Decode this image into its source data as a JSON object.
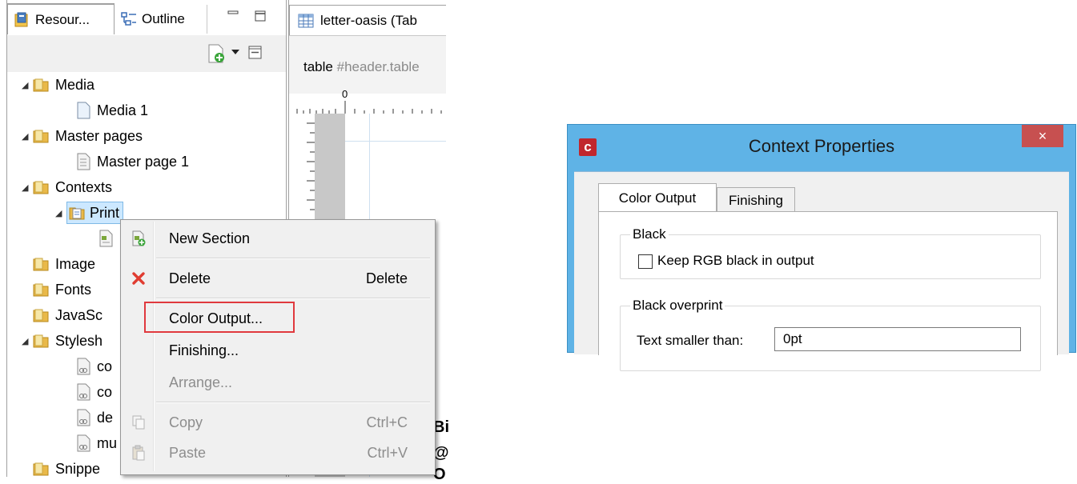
{
  "resources_view": {
    "tabs": [
      {
        "label": "Resour...",
        "icon": "resources-icon"
      },
      {
        "label": "Outline",
        "icon": "outline-icon"
      }
    ],
    "minimize_glyph": "▭",
    "tree": [
      {
        "label": "Media",
        "expanded": true,
        "icon": "folder-icon"
      },
      {
        "label": "Media 1",
        "icon": "page-icon",
        "level": 2
      },
      {
        "label": "Master pages",
        "expanded": true,
        "icon": "folder-icon"
      },
      {
        "label": "Master page 1",
        "icon": "page-icon",
        "level": 2
      },
      {
        "label": "Contexts",
        "expanded": true,
        "icon": "folder-icon"
      },
      {
        "label": "Print",
        "expanded": true,
        "selected": true,
        "icon": "print-context-icon",
        "level": 2
      },
      {
        "label": "",
        "icon": "section-icon",
        "level": 3
      },
      {
        "label": "Image",
        "icon": "folder-icon"
      },
      {
        "label": "Fonts",
        "icon": "folder-icon"
      },
      {
        "label": "JavaSc",
        "icon": "folder-icon"
      },
      {
        "label": "Stylesh",
        "expanded": true,
        "icon": "folder-icon"
      },
      {
        "label": "co",
        "icon": "stylesheet-icon",
        "level": 2
      },
      {
        "label": "co",
        "icon": "stylesheet-icon",
        "level": 2
      },
      {
        "label": "de",
        "icon": "stylesheet-icon",
        "level": 2
      },
      {
        "label": "mu",
        "icon": "stylesheet-icon",
        "level": 2
      },
      {
        "label": "Snippe",
        "icon": "folder-icon"
      }
    ]
  },
  "editor": {
    "tab_label": "letter-oasis (Tab",
    "breadcrumb_element": "table",
    "breadcrumb_selector": "#header.table",
    "ruler_zero": "0",
    "fragments": [
      "Bi",
      "@",
      "O"
    ]
  },
  "context_menu": {
    "items": [
      {
        "label": "New Section",
        "shortcut": "",
        "icon": "new-section-icon",
        "enabled": true
      },
      {
        "label": "Delete",
        "shortcut": "Delete",
        "icon": "delete-x-icon",
        "enabled": true
      },
      {
        "label": "Color Output...",
        "shortcut": "",
        "icon": "",
        "enabled": true,
        "highlighted": true
      },
      {
        "label": "Finishing...",
        "shortcut": "",
        "icon": "",
        "enabled": true
      },
      {
        "label": "Arrange...",
        "shortcut": "",
        "icon": "",
        "enabled": false
      },
      {
        "label": "Copy",
        "shortcut": "Ctrl+C",
        "icon": "copy-icon",
        "enabled": false
      },
      {
        "label": "Paste",
        "shortcut": "Ctrl+V",
        "icon": "paste-icon",
        "enabled": false
      }
    ],
    "highlight_color": "#e0393e"
  },
  "dialog": {
    "app_icon_letter": "c",
    "title": "Context Properties",
    "close_glyph": "×",
    "tabs": [
      "Color Output",
      "Finishing"
    ],
    "active_tab": "Color Output",
    "groups": {
      "black": {
        "legend": "Black",
        "checkbox_label": "Keep RGB black in output",
        "checked": false
      },
      "overprint": {
        "legend": "Black overprint",
        "field_label": "Text smaller than:",
        "field_value": "0pt"
      }
    },
    "frame_color": "#5fb3e6",
    "close_color": "#c75050"
  }
}
